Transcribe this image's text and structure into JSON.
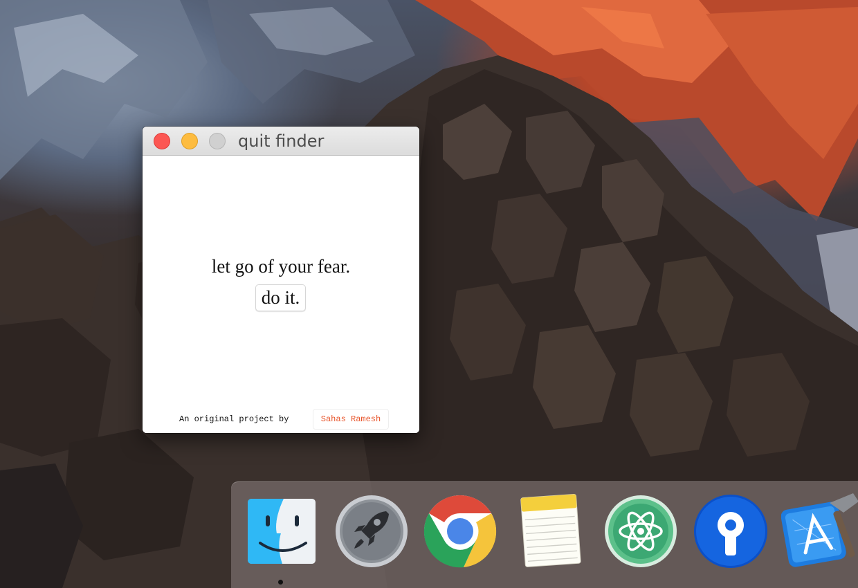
{
  "window": {
    "title": "quit finder",
    "headline": "let go of your fear.",
    "button_label": "do it.",
    "credit_text": "An original project by",
    "author_name": "Sahas Ramesh"
  },
  "dock": {
    "items": [
      {
        "name": "Finder",
        "icon": "finder-icon",
        "running": true
      },
      {
        "name": "Launchpad",
        "icon": "launchpad-icon",
        "running": false
      },
      {
        "name": "Google Chrome",
        "icon": "chrome-icon",
        "running": false
      },
      {
        "name": "Notes",
        "icon": "notes-icon",
        "running": false
      },
      {
        "name": "Atom",
        "icon": "atom-icon",
        "running": false
      },
      {
        "name": "Sourcetree",
        "icon": "sourcetree-icon",
        "running": false
      },
      {
        "name": "Xcode",
        "icon": "xcode-icon",
        "running": false
      }
    ]
  },
  "colors": {
    "close": "#fc5753",
    "minimize": "#fdbc40",
    "zoom_disabled": "#d0d0d0",
    "author_link": "#e8542a"
  }
}
